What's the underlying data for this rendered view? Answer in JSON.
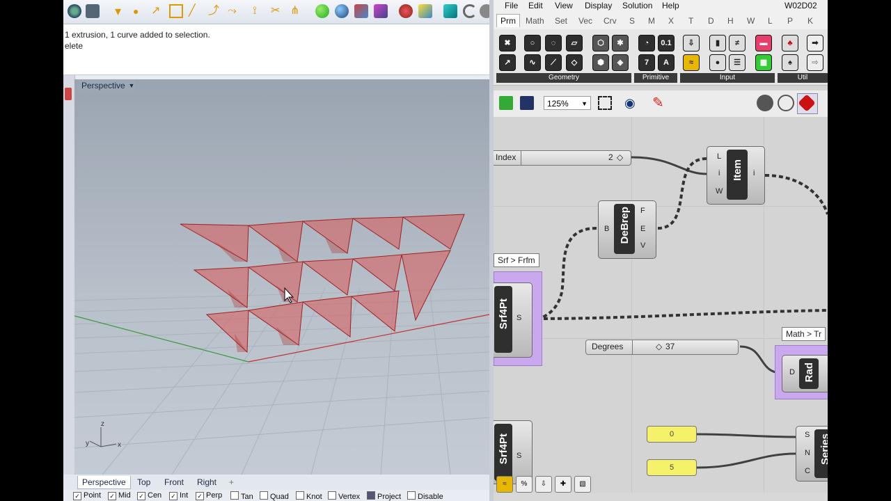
{
  "rhino": {
    "command_history": [
      "1 extrusion, 1 curve added to selection.",
      "elete"
    ],
    "viewport_title": "Perspective",
    "viewport_tabs": [
      "Perspective",
      "Top",
      "Front",
      "Right"
    ],
    "add_tab_glyph": "+",
    "axis_labels": {
      "z": "z",
      "y": "y",
      "x": "x"
    },
    "osnaps": [
      {
        "label": "Point",
        "checked": true
      },
      {
        "label": "Mid",
        "checked": true
      },
      {
        "label": "Cen",
        "checked": true
      },
      {
        "label": "Int",
        "checked": true
      },
      {
        "label": "Perp",
        "checked": true
      },
      {
        "label": "Tan",
        "checked": false
      },
      {
        "label": "Quad",
        "checked": false
      },
      {
        "label": "Knot",
        "checked": false
      },
      {
        "label": "Vertex",
        "checked": false
      },
      {
        "label": "Project",
        "checked": false
      },
      {
        "label": "Disable",
        "checked": false
      }
    ]
  },
  "gh": {
    "menus": [
      "File",
      "Edit",
      "View",
      "Display",
      "Solution",
      "Help"
    ],
    "doc_title": "W02D02",
    "tabs": [
      "Prm",
      "Math",
      "Set",
      "Vec",
      "Crv",
      "S",
      "M",
      "X",
      "T",
      "D",
      "H",
      "W",
      "L",
      "P",
      "K"
    ],
    "ribbon_groups": [
      "Geometry",
      "Primitive",
      "Input",
      "Util"
    ],
    "zoom": "125%",
    "components": {
      "index_slider": {
        "label": "Index",
        "value": "2"
      },
      "item": {
        "name": "Item",
        "inputs": [
          "L",
          "i",
          "W"
        ],
        "output": "i"
      },
      "debrep": {
        "name": "DeBrep",
        "input": "B",
        "outputs": [
          "F",
          "E",
          "V"
        ]
      },
      "tooltip1": "Srf > Frfm",
      "srf4pt": {
        "name": "Srf4Pt",
        "output": "S"
      },
      "degrees_slider": {
        "label": "Degrees",
        "value": "37"
      },
      "tooltip2": "Math > Tr",
      "rad": {
        "name": "Rad",
        "input": "D"
      },
      "srf4pt2": {
        "name": "Srf4Pt",
        "output": "S"
      },
      "panel_0": "0",
      "panel_5": "5",
      "series": {
        "name": "Series",
        "inputs": [
          "S",
          "N",
          "C"
        ]
      }
    }
  },
  "colors": {
    "extrusion": "#d04a4a",
    "component_dark": "#2f2f2f",
    "selected": "#c9a8ee",
    "panel": "#f5f26a"
  }
}
